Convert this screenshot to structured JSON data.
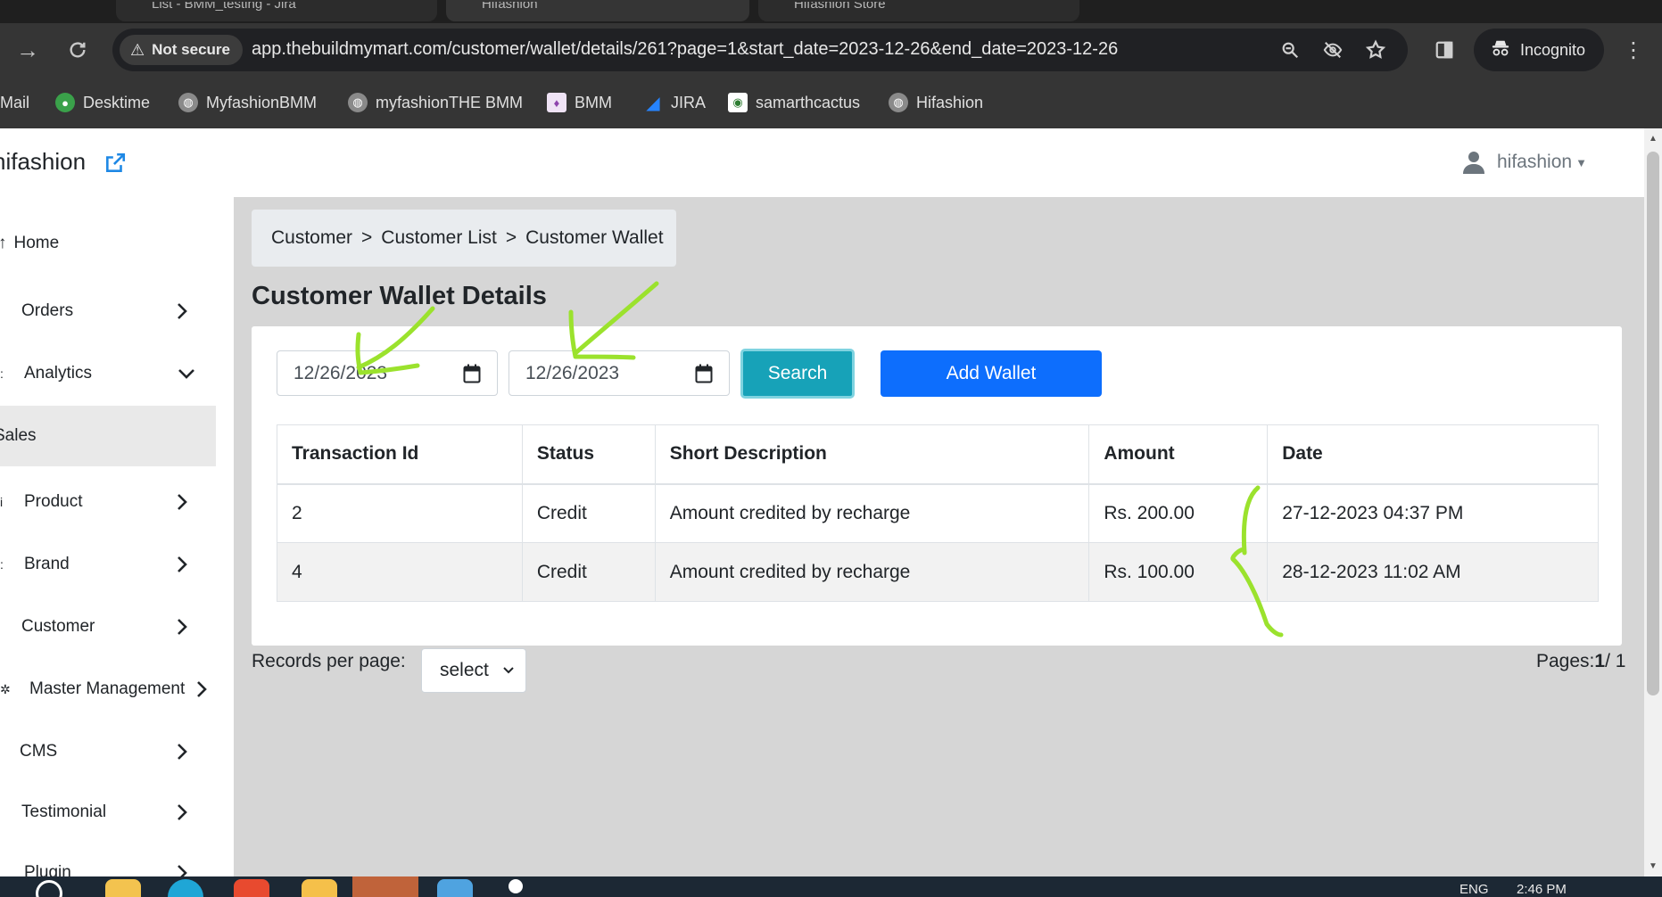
{
  "browser": {
    "tabs": [
      {
        "label": "List - BMM_testing - Jira",
        "active": false
      },
      {
        "label": "Hifashion",
        "active": true
      },
      {
        "label": "Hifashion Store",
        "active": false
      }
    ],
    "security_label": "Not secure",
    "url": "app.thebuildmymart.com/customer/wallet/details/261?page=1&start_date=2023-12-26&end_date=2023-12-26",
    "incognito_label": "Incognito",
    "bookmarks": [
      "Mail",
      "Desktime",
      "MyfashionBMM",
      "myfashionTHE BMM",
      "BMM",
      "JIRA",
      "samarthcactus",
      "Hifashion"
    ]
  },
  "header": {
    "brand": "hifashion",
    "user": "hifashion"
  },
  "sidebar": {
    "items": [
      {
        "label": "Home"
      },
      {
        "label": "Orders"
      },
      {
        "label": "Analytics"
      },
      {
        "label": "Sales"
      },
      {
        "label": "Product"
      },
      {
        "label": "Brand"
      },
      {
        "label": "Customer"
      },
      {
        "label": "Master Management"
      },
      {
        "label": "CMS"
      },
      {
        "label": "Testimonial"
      },
      {
        "label": "Plugin"
      }
    ]
  },
  "breadcrumb": {
    "items": [
      "Customer",
      "Customer List",
      "Customer Wallet"
    ],
    "separator": ">"
  },
  "page": {
    "title": "Customer Wallet Details"
  },
  "filters": {
    "start_date": "12/26/2023",
    "end_date": "12/26/2023",
    "search_label": "Search",
    "add_wallet_label": "Add Wallet"
  },
  "table": {
    "columns": [
      "Transaction Id",
      "Status",
      "Short Description",
      "Amount",
      "Date"
    ],
    "rows": [
      [
        "2",
        "Credit",
        "Amount credited by recharge",
        "Rs. 200.00",
        "27-12-2023 04:37 PM"
      ],
      [
        "4",
        "Credit",
        "Amount credited by recharge",
        "Rs. 100.00",
        "28-12-2023 11:02 AM"
      ]
    ]
  },
  "pagination": {
    "records_label": "Records per page:",
    "select_value": "select",
    "pages_label": "Pages:",
    "current_page": "1",
    "total_pages": "/ 1"
  },
  "taskbar": {
    "lang": "ENG",
    "time": "2:46 PM"
  },
  "colors": {
    "search_button": "#17a2b8",
    "add_button": "#0d6efd",
    "annotation": "#9be22d"
  }
}
